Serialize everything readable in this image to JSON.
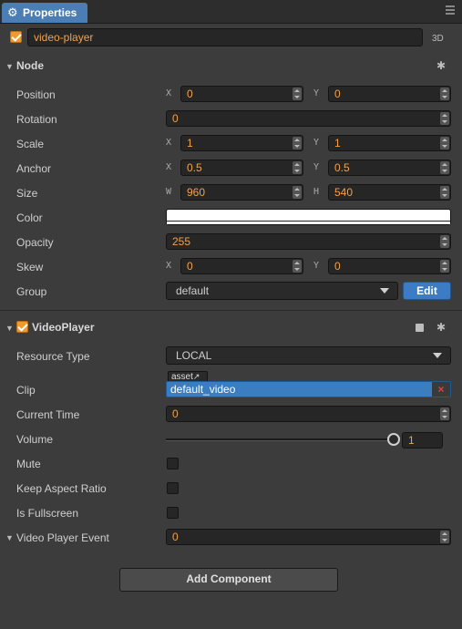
{
  "tab": {
    "title": "Properties",
    "icon": "gear-icon"
  },
  "node_header": {
    "enabled": true,
    "name": "video-player",
    "mode_label": "3D"
  },
  "node_section": {
    "title": "Node",
    "position": {
      "label": "Position",
      "x_axis": "X",
      "x": "0",
      "y_axis": "Y",
      "y": "0"
    },
    "rotation": {
      "label": "Rotation",
      "value": "0"
    },
    "scale": {
      "label": "Scale",
      "x_axis": "X",
      "x": "1",
      "y_axis": "Y",
      "y": "1"
    },
    "anchor": {
      "label": "Anchor",
      "x_axis": "X",
      "x": "0.5",
      "y_axis": "Y",
      "y": "0.5"
    },
    "size": {
      "label": "Size",
      "w_axis": "W",
      "w": "960",
      "h_axis": "H",
      "h": "540"
    },
    "color": {
      "label": "Color",
      "value": "#ffffff"
    },
    "opacity": {
      "label": "Opacity",
      "value": "255"
    },
    "skew": {
      "label": "Skew",
      "x_axis": "X",
      "x": "0",
      "y_axis": "Y",
      "y": "0"
    },
    "group": {
      "label": "Group",
      "value": "default",
      "edit_label": "Edit"
    }
  },
  "video_section": {
    "title": "VideoPlayer",
    "enabled": true,
    "resource_type": {
      "label": "Resource Type",
      "value": "LOCAL"
    },
    "clip": {
      "label": "Clip",
      "tag": "asset",
      "value": "default_video",
      "clear": "×"
    },
    "current_time": {
      "label": "Current Time",
      "value": "0"
    },
    "volume": {
      "label": "Volume",
      "value": "1",
      "level": 1.0
    },
    "mute": {
      "label": "Mute",
      "checked": false
    },
    "keep_aspect": {
      "label": "Keep Aspect Ratio",
      "checked": false
    },
    "fullscreen": {
      "label": "Is Fullscreen",
      "checked": false
    },
    "event": {
      "label": "Video Player Event",
      "value": "0"
    }
  },
  "add_component_label": "Add Component",
  "colors": {
    "accent": "#f3a14c",
    "tab": "#4a7eb5",
    "edit_button": "#3b7cc4",
    "asset_field": "#3a7dc0"
  }
}
